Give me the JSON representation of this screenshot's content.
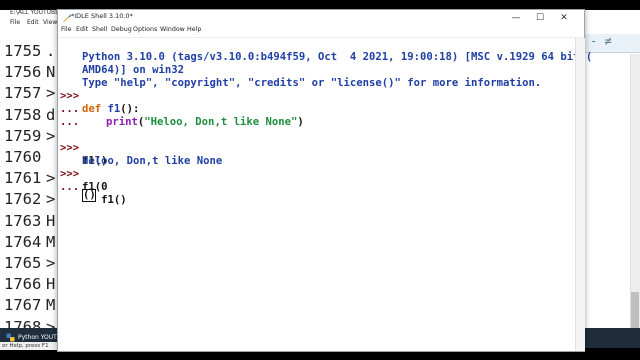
{
  "background_window": {
    "title": "E:\\ALL YOUTUBE C",
    "menu": [
      "File",
      "Edit",
      "View"
    ],
    "lines": [
      {
        "num": "1755",
        "tail": "."
      },
      {
        "num": "1756",
        "tail": "N"
      },
      {
        "num": "1757",
        "tail": ">"
      },
      {
        "num": "1758",
        "tail": "d"
      },
      {
        "num": "1759",
        "tail": ">"
      },
      {
        "num": "1760",
        "tail": ""
      },
      {
        "num": "1761",
        "tail": ">"
      },
      {
        "num": "1762",
        "tail": ">"
      },
      {
        "num": "1763",
        "tail": "H"
      },
      {
        "num": "1764",
        "tail": "M"
      },
      {
        "num": "1765",
        "tail": ">"
      },
      {
        "num": "1766",
        "tail": "H"
      },
      {
        "num": "1767",
        "tail": "M"
      },
      {
        "num": "1768",
        "tail": ">"
      }
    ],
    "right_fragment": "-  ≠"
  },
  "taskbar": {
    "item_label": "Python YOUTUB"
  },
  "status": {
    "text": "or Help, press F1"
  },
  "idle": {
    "title": "*IDLE Shell 3.10.0*",
    "menu": [
      "File",
      "Edit",
      "Shell",
      "Debug",
      "Options",
      "Window",
      "Help"
    ],
    "buttons": {
      "minimize": "—",
      "maximize": "☐",
      "close": "✕"
    },
    "lines": {
      "l1": "Python 3.10.0 (tags/v3.10.0:b494f59, Oct  4 2021, 19:00:18) [MSC v.1929 64 bit (",
      "l2": "AMD64)] on win32",
      "l3": "Type \"help\", \"copyright\", \"credits\" or \"license()\" for more information.",
      "p_main": ">>>",
      "p_cont": "...",
      "def_kw": "def",
      "def_name": "f1",
      "def_rest": "():",
      "print_kw": "print",
      "print_open": "(",
      "print_str": "\"Heloo, Don,t like None\"",
      "print_close": ")",
      "call1": "f1()",
      "out1": "Heloo, Don,t like None",
      "call2": "f1(0",
      "call2b": "   f1()",
      "cursor": "()"
    }
  }
}
